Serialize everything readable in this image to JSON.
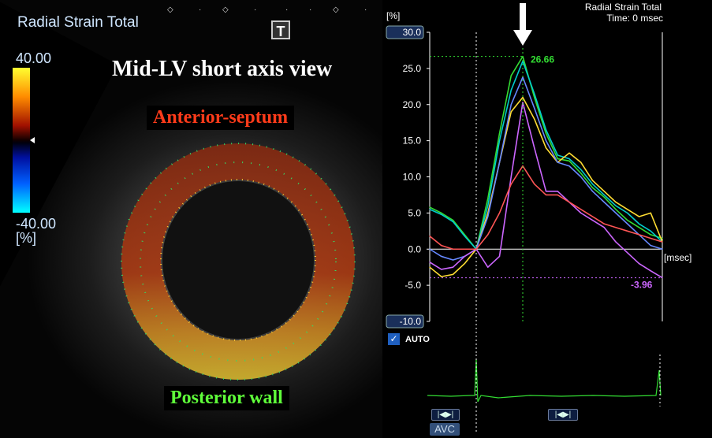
{
  "left_panel": {
    "title": "Radial Strain Total",
    "t_button": "T",
    "scale_max": "40.00",
    "scale_min": "-40.00",
    "scale_unit": "[%]",
    "view_label": "Mid-LV short axis view",
    "top_label": "Anterior-septum",
    "bottom_label": "Posterior wall"
  },
  "right_panel": {
    "title": "Radial Strain Total",
    "time_label": "Time: 0 msec",
    "auto_label": "AUTO",
    "avc_label": "AVC",
    "peak_label": "26.66",
    "min_label": "-3.96"
  },
  "chart_data": {
    "type": "line",
    "ylabel": "[%]",
    "xlabel": "[msec]",
    "ylim": [
      -10,
      30
    ],
    "yticks": [
      "30.0",
      "25.0",
      "20.0",
      "15.0",
      "10.0",
      "5.0",
      "0.0",
      "-5.0",
      "-10.0"
    ],
    "x": [
      0,
      5,
      10,
      15,
      20,
      25,
      30,
      35,
      40,
      45,
      50,
      55,
      60,
      65,
      70,
      75,
      80,
      85,
      90,
      95,
      100
    ],
    "series": [
      {
        "color": "#33dd33",
        "values": [
          5.8,
          5.0,
          4.0,
          2.0,
          0.0,
          7.0,
          16.0,
          24.0,
          26.66,
          21.0,
          16.0,
          12.5,
          12.2,
          10.5,
          8.5,
          7.2,
          5.5,
          4.0,
          3.0,
          2.0,
          1.5
        ]
      },
      {
        "color": "#00cccc",
        "values": [
          5.5,
          4.8,
          3.8,
          1.8,
          0.0,
          6.0,
          15.0,
          22.0,
          26.0,
          21.5,
          16.5,
          13.0,
          12.5,
          11.0,
          9.0,
          7.5,
          6.0,
          5.0,
          3.5,
          2.5,
          1.0
        ]
      },
      {
        "color": "#ffdd33",
        "values": [
          -2.5,
          -3.8,
          -3.5,
          -2.0,
          0.0,
          5.0,
          12.0,
          19.0,
          21.0,
          18.0,
          14.0,
          12.0,
          13.3,
          12.0,
          9.5,
          8.0,
          6.5,
          5.5,
          4.5,
          5.0,
          1.0
        ]
      },
      {
        "color": "#6688ff",
        "values": [
          0.0,
          -1.0,
          -1.5,
          -1.0,
          0.0,
          4.5,
          12.0,
          20.0,
          23.8,
          19.5,
          15.0,
          12.0,
          11.5,
          10.0,
          8.0,
          6.5,
          5.0,
          3.5,
          2.0,
          0.5,
          0.0
        ]
      },
      {
        "color": "#cc66ff",
        "values": [
          -1.8,
          -2.8,
          -2.5,
          -1.0,
          0.0,
          -2.5,
          -1.0,
          10.0,
          20.3,
          14.0,
          8.0,
          8.0,
          6.5,
          5.0,
          4.0,
          3.0,
          1.0,
          -0.5,
          -2.0,
          -3.0,
          -3.96
        ]
      },
      {
        "color": "#ff5555",
        "values": [
          1.8,
          0.5,
          0.0,
          0.0,
          0.0,
          2.0,
          5.0,
          9.0,
          11.5,
          9.0,
          7.5,
          7.5,
          6.5,
          5.5,
          4.5,
          3.5,
          3.0,
          2.5,
          2.0,
          1.5,
          1.0
        ]
      }
    ]
  }
}
